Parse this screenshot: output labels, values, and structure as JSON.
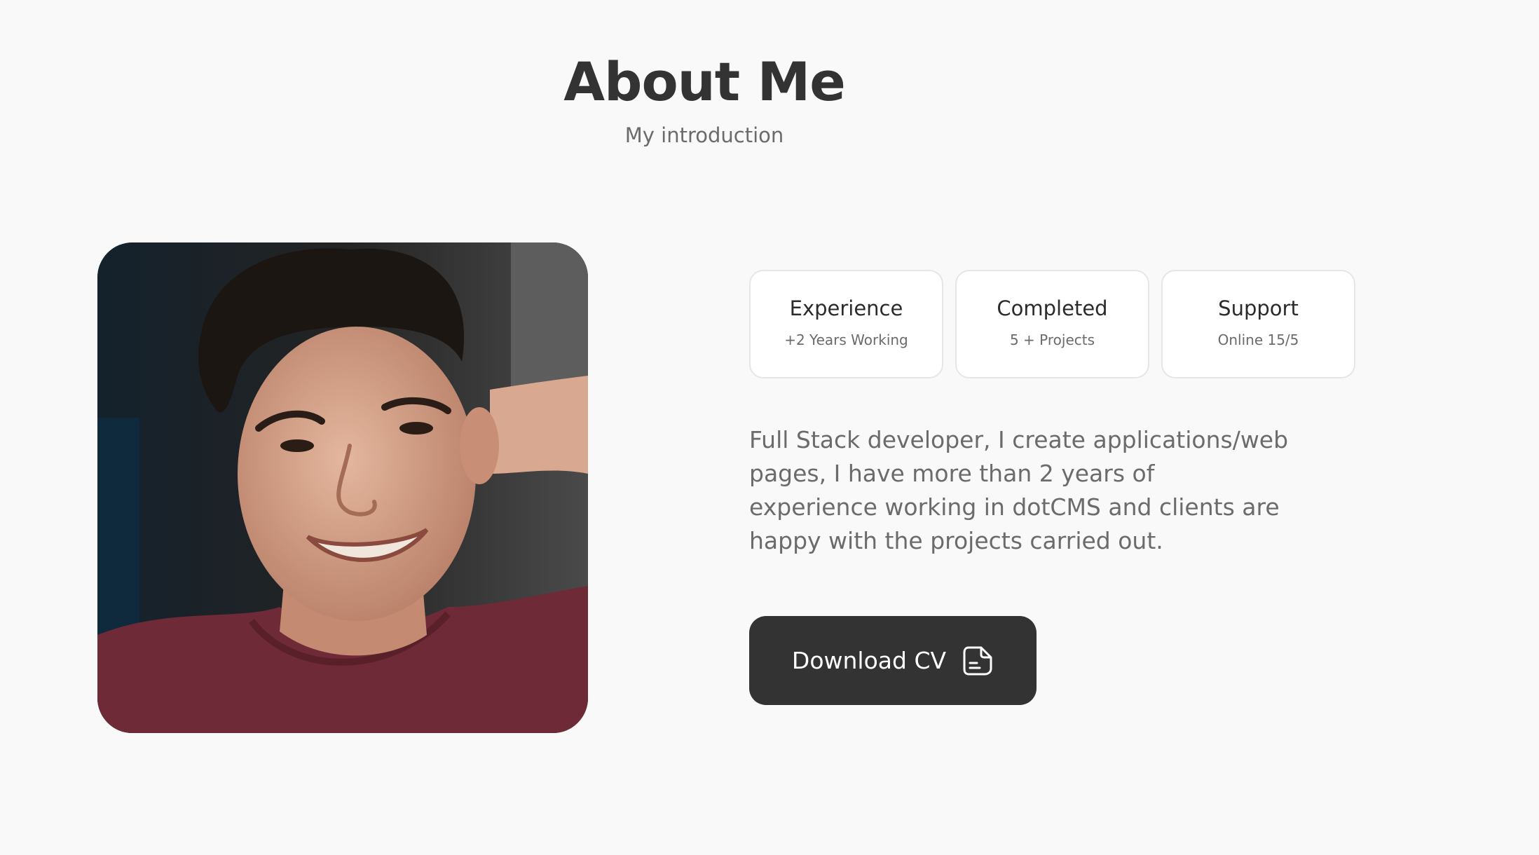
{
  "header": {
    "title": "About Me",
    "subtitle": "My introduction"
  },
  "photo": {
    "alt": "profile-photo"
  },
  "stats": [
    {
      "title": "Experience",
      "subtitle": "+2 Years Working"
    },
    {
      "title": "Completed",
      "subtitle": "5 + Projects"
    },
    {
      "title": "Support",
      "subtitle": "Online 15/5"
    }
  ],
  "description": "Full Stack developer, I create applications/web pages, I have more than 2 years of experience working in dotCMS and clients are happy with the projects carried out.",
  "download_button": {
    "label": "Download CV",
    "icon": "document-icon"
  },
  "colors": {
    "background": "#f9f9f9",
    "button": "#333333",
    "heading": "#333333",
    "muted_text": "#6b6b6b"
  }
}
